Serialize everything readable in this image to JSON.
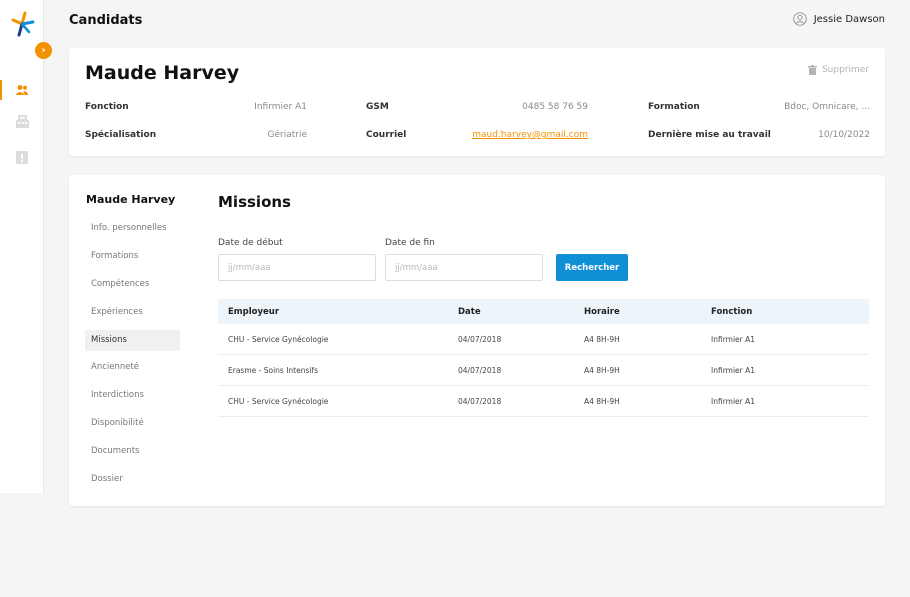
{
  "app": {
    "page_title": "Candidats",
    "user_name": "Jessie Dawson",
    "accent_color": "#f39200",
    "primary_color": "#0f8fd6"
  },
  "sidebar": {
    "toggle_icon": "chevron-right-icon",
    "items": [
      {
        "icon": "users-icon",
        "active": true
      },
      {
        "icon": "building-icon",
        "active": false
      },
      {
        "icon": "book-icon",
        "active": false
      }
    ]
  },
  "candidate": {
    "name": "Maude Harvey",
    "delete_label": "Supprimer",
    "fields": [
      {
        "label": "Fonction",
        "value": "Infirmier A1"
      },
      {
        "label": "GSM",
        "value": "0485 58 76 59"
      },
      {
        "label": "Formation",
        "value": "Bdoc, Omnicare, ..."
      },
      {
        "label": "Spécialisation",
        "value": "Gériatrie"
      },
      {
        "label": "Courriel",
        "value": "maud.harvey@gmail.com"
      },
      {
        "label": "Dernière mise au travail",
        "value": "10/10/2022"
      }
    ]
  },
  "side_menu": {
    "title": "Maude Harvey",
    "items": [
      "Info. personnelles",
      "Formations",
      "Compétences",
      "Expériences",
      "Missions",
      "Ancienneté",
      "Interdictions",
      "Disponibilité",
      "Documents",
      "Dossier"
    ],
    "active": "Missions"
  },
  "missions": {
    "title": "Missions",
    "start_label": "Date de début",
    "end_label": "Date de fin",
    "start_placeholder": "jj/mm/aaa",
    "end_placeholder": "jj/mm/aaa",
    "search_label": "Rechercher",
    "columns": [
      "Employeur",
      "Date",
      "Horaire",
      "Fonction"
    ],
    "rows": [
      [
        "CHU - Service Gynécologie",
        "04/07/2018",
        "A4 8H-9H",
        "Infirmier A1"
      ],
      [
        "Erasme - Soins Intensifs",
        "04/07/2018",
        "A4 8H-9H",
        "Infirmier A1"
      ],
      [
        "CHU - Service Gynécologie",
        "04/07/2018",
        "A4 8H-9H",
        "Infirmier A1"
      ]
    ]
  }
}
